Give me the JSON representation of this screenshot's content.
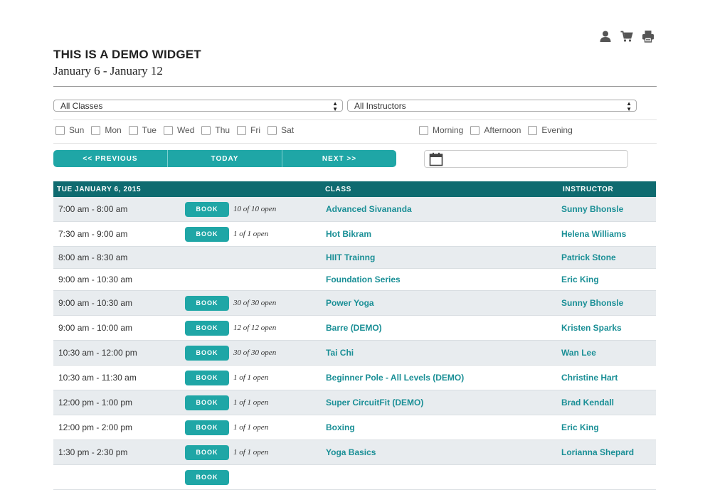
{
  "top_icons": [
    "user-icon",
    "cart-icon",
    "print-icon"
  ],
  "header": {
    "title": "THIS IS A DEMO WIDGET",
    "date_range": "January 6 - January 12"
  },
  "filters": {
    "classes_select": {
      "value": "All Classes"
    },
    "instructors_select": {
      "value": "All Instructors"
    },
    "days": [
      "Sun",
      "Mon",
      "Tue",
      "Wed",
      "Thu",
      "Fri",
      "Sat"
    ],
    "times_of_day": [
      "Morning",
      "Afternoon",
      "Evening"
    ]
  },
  "nav": {
    "previous": "<< PREVIOUS",
    "today": "TODAY",
    "next": "NEXT >>"
  },
  "date_picker": {
    "value": "",
    "icon": "calendar-icon"
  },
  "table": {
    "date_header": "TUE JANUARY 6, 2015",
    "class_header": "CLASS",
    "instructor_header": "INSTRUCTOR",
    "book_label": "BOOK",
    "rows": [
      {
        "time": "7:00 am - 8:00 am",
        "bookable": true,
        "open": "10 of 10 open",
        "class": "Advanced Sivananda",
        "instructor": "Sunny Bhonsle"
      },
      {
        "time": "7:30 am - 9:00 am",
        "bookable": true,
        "open": "1 of 1 open",
        "class": "Hot Bikram",
        "instructor": "Helena Williams"
      },
      {
        "time": "8:00 am - 8:30 am",
        "bookable": false,
        "open": "",
        "class": "HIIT Trainng",
        "instructor": "Patrick Stone"
      },
      {
        "time": "9:00 am - 10:30 am",
        "bookable": false,
        "open": "",
        "class": "Foundation Series",
        "instructor": "Eric King"
      },
      {
        "time": "9:00 am - 10:30 am",
        "bookable": true,
        "open": "30 of 30 open",
        "class": "Power Yoga",
        "instructor": "Sunny Bhonsle"
      },
      {
        "time": "9:00 am - 10:00 am",
        "bookable": true,
        "open": "12 of 12 open",
        "class": "Barre (DEMO)",
        "instructor": "Kristen Sparks"
      },
      {
        "time": "10:30 am - 12:00 pm",
        "bookable": true,
        "open": "30 of 30 open",
        "class": "Tai Chi",
        "instructor": "Wan Lee"
      },
      {
        "time": "10:30 am - 11:30 am",
        "bookable": true,
        "open": "1 of 1 open",
        "class": "Beginner Pole - All Levels (DEMO)",
        "instructor": "Christine Hart"
      },
      {
        "time": "12:00 pm - 1:00 pm",
        "bookable": true,
        "open": "1 of 1 open",
        "class": "Super CircuitFit (DEMO)",
        "instructor": "Brad Kendall"
      },
      {
        "time": "12:00 pm - 2:00 pm",
        "bookable": true,
        "open": "1 of 1 open",
        "class": "Boxing",
        "instructor": "Eric King"
      },
      {
        "time": "1:30 pm - 2:30 pm",
        "bookable": true,
        "open": "1 of 1 open",
        "class": "Yoga Basics",
        "instructor": "Lorianna Shepard"
      },
      {
        "time": "",
        "bookable": true,
        "open": "",
        "class": "",
        "instructor": ""
      }
    ]
  },
  "colors": {
    "accent": "#1fa6a6",
    "header_bg": "#0f6b70",
    "link": "#1a8f96",
    "row_alt": "#e8ecef"
  }
}
